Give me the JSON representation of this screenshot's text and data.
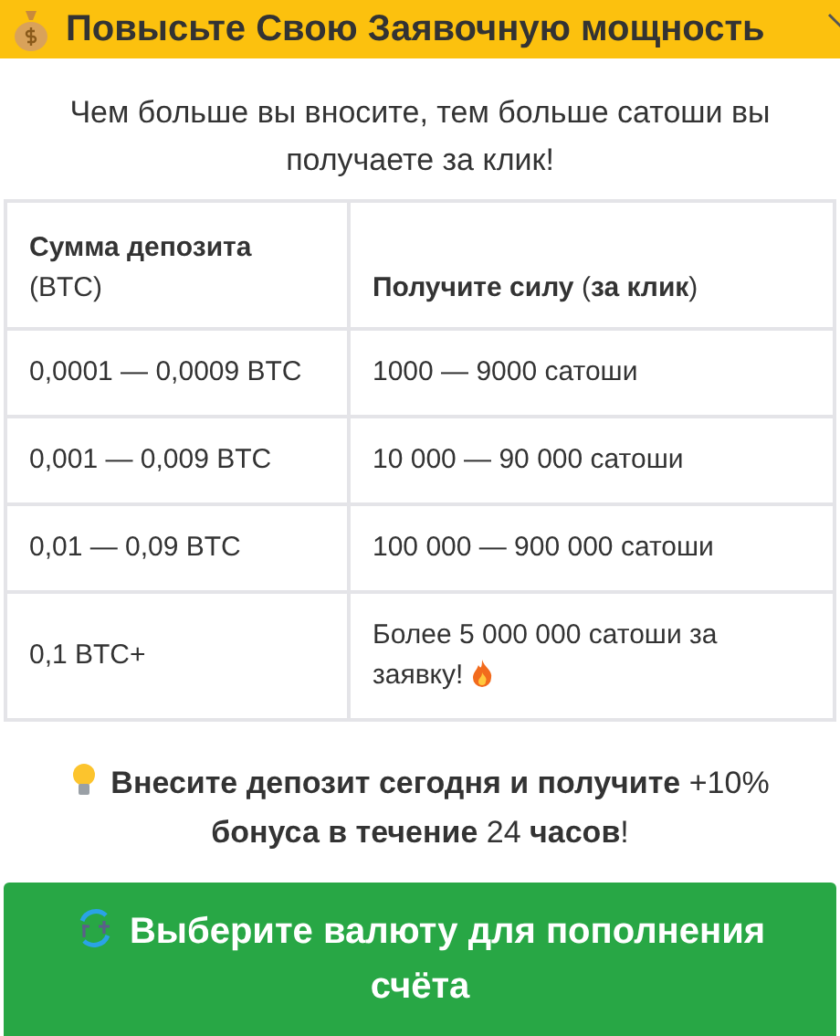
{
  "header": {
    "title": "Повысьте Свою Заявочную мощность"
  },
  "intro": "Чем больше вы вносите, тем больше сатоши вы получаете за клик!",
  "table": {
    "columns": [
      {
        "title": "Сумма депозита",
        "subtitle": "(BTC)"
      },
      {
        "title": "**Получите силу** (**за клик**)"
      }
    ],
    "rows": [
      {
        "deposit": "0,0001 — 0,0009 BTC",
        "power": "1000 — 9000 сатоши",
        "fire": false
      },
      {
        "deposit": "0,001 — 0,009 BTC",
        "power": "10 000 — 90 000 сатоши",
        "fire": false
      },
      {
        "deposit": "0,01 — 0,09 BTC",
        "power": "100 000 — 900 000 сатоши",
        "fire": false
      },
      {
        "deposit": "0,1 BTC+",
        "power": "Более 5 000 000 сатоши за заявку!",
        "fire": true
      }
    ]
  },
  "bonus": "**Внесите депозит сегодня и получите** +10% **бонуса в течение** 24 **часов**!",
  "button": {
    "label": "Выберите валюту для пополнения счёта"
  }
}
